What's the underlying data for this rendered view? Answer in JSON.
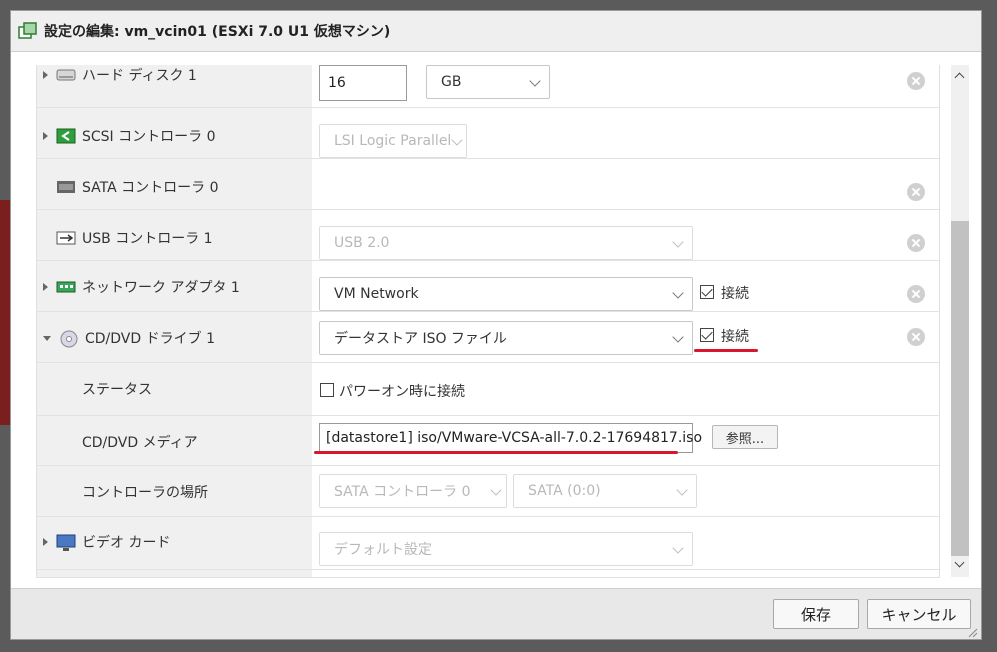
{
  "window": {
    "title": "設定の編集: vm_vcin01 (ESXi 7.0 U1 仮想マシン)"
  },
  "rows": {
    "hdd": {
      "label": "ハード ディスク 1",
      "size_value": "16",
      "unit": "GB"
    },
    "scsi": {
      "label": "SCSI コントローラ 0",
      "type": "LSI Logic Parallel"
    },
    "sata": {
      "label": "SATA コントローラ 0"
    },
    "usb": {
      "label": "USB コントローラ 1",
      "type": "USB 2.0"
    },
    "network": {
      "label": "ネットワーク アダプタ 1",
      "network": "VM Network",
      "connect_label": "接続",
      "connected": true
    },
    "cddvd": {
      "label": "CD/DVD ドライブ 1",
      "source": "データストア ISO ファイル",
      "connect_label": "接続",
      "connected": true
    },
    "status": {
      "label": "ステータス",
      "poweron_label": "パワーオン時に接続",
      "poweron_connect": false
    },
    "media": {
      "label": "CD/DVD メディア",
      "path": "[datastore1] iso/VMware-VCSA-all-7.0.2-17694817.iso",
      "browse_label": "参照..."
    },
    "controller_location": {
      "label": "コントローラの場所",
      "controller": "SATA コントローラ 0",
      "slot": "SATA (0:0)"
    },
    "video": {
      "label": "ビデオ カード",
      "setting": "デフォルト設定"
    }
  },
  "footer": {
    "save_label": "保存",
    "cancel_label": "キャンセル"
  },
  "colors": {
    "highlight": "#d9162c",
    "label_bg": "#f0f0f0"
  }
}
